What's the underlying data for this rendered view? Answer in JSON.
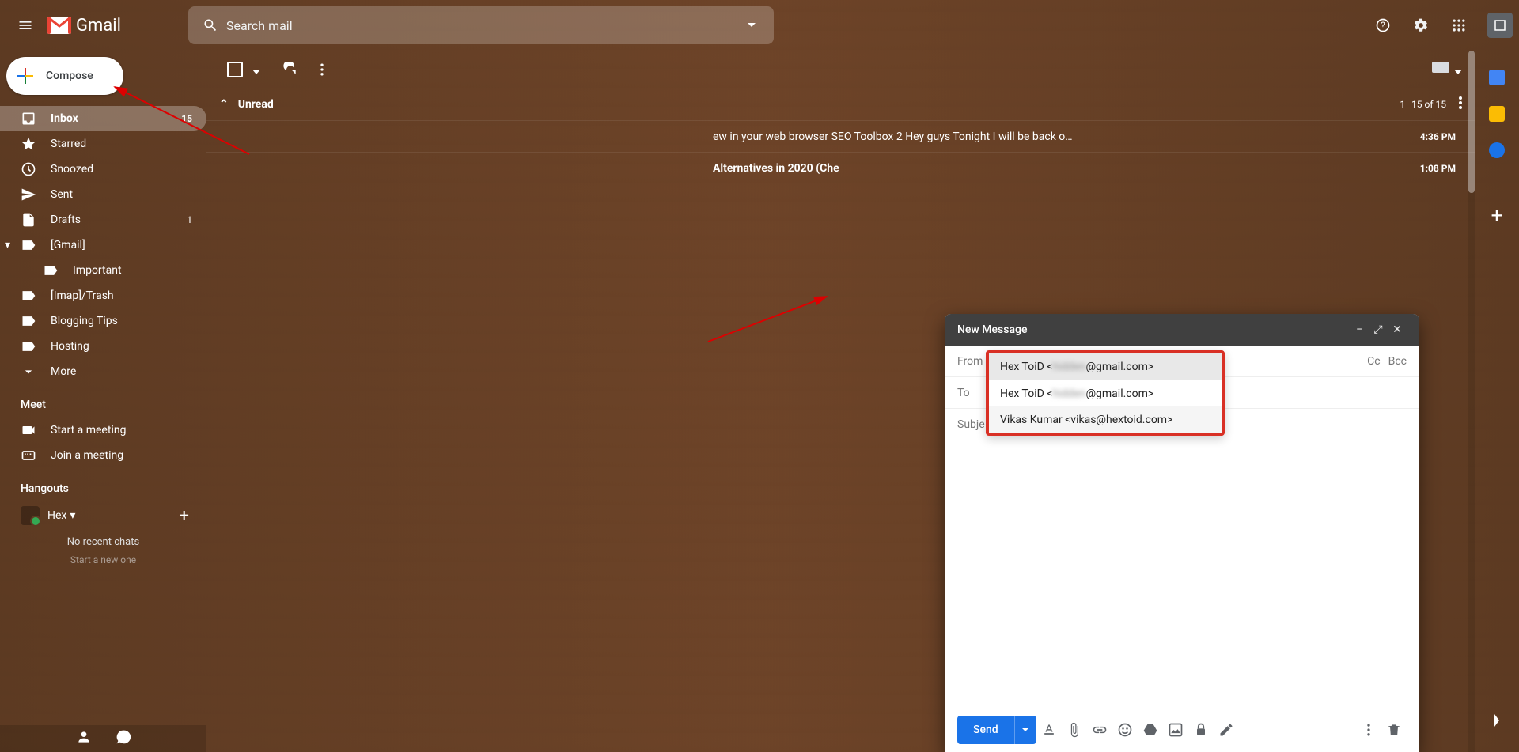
{
  "header": {
    "logo_text": "Gmail",
    "search_placeholder": "Search mail"
  },
  "sidebar": {
    "compose": "Compose",
    "nav": [
      {
        "label": "Inbox",
        "count": "15"
      },
      {
        "label": "Starred"
      },
      {
        "label": "Snoozed"
      },
      {
        "label": "Sent"
      },
      {
        "label": "Drafts",
        "count": "1"
      },
      {
        "label": "[Gmail]"
      },
      {
        "label": "Important"
      },
      {
        "label": "[Imap]/Trash"
      },
      {
        "label": "Blogging Tips"
      },
      {
        "label": "Hosting"
      },
      {
        "label": "More"
      }
    ],
    "meet_head": "Meet",
    "meet_items": [
      "Start a meeting",
      "Join a meeting"
    ],
    "hangouts_head": "Hangouts",
    "hangouts_user": "Hex",
    "hangouts_msg1": "No recent chats",
    "hangouts_msg2": "Start a new one"
  },
  "main": {
    "unread_label": "Unread",
    "pagination": "1–15 of 15",
    "rows": [
      {
        "snippet": "ew in your web browser SEO Toolbox 2 Hey guys Tonight I will be back o…",
        "time": "4:36 PM"
      },
      {
        "snippet": "Alternatives in 2020 (Che",
        "time": "1:08 PM"
      }
    ]
  },
  "compose_window": {
    "title": "New Message",
    "from_label": "From",
    "to_label": "To",
    "subject_label": "Subje",
    "cc": "Cc",
    "bcc": "Bcc",
    "from_value_prefix": "Hex ToiD <",
    "from_value_suffix": "@gmail.com>",
    "options": [
      {
        "prefix": "Hex ToiD <",
        "suffix": "@gmail.com>"
      },
      {
        "prefix": "Vikas Kumar <vikas@hextoid.com>",
        "suffix": ""
      }
    ],
    "send": "Send"
  }
}
